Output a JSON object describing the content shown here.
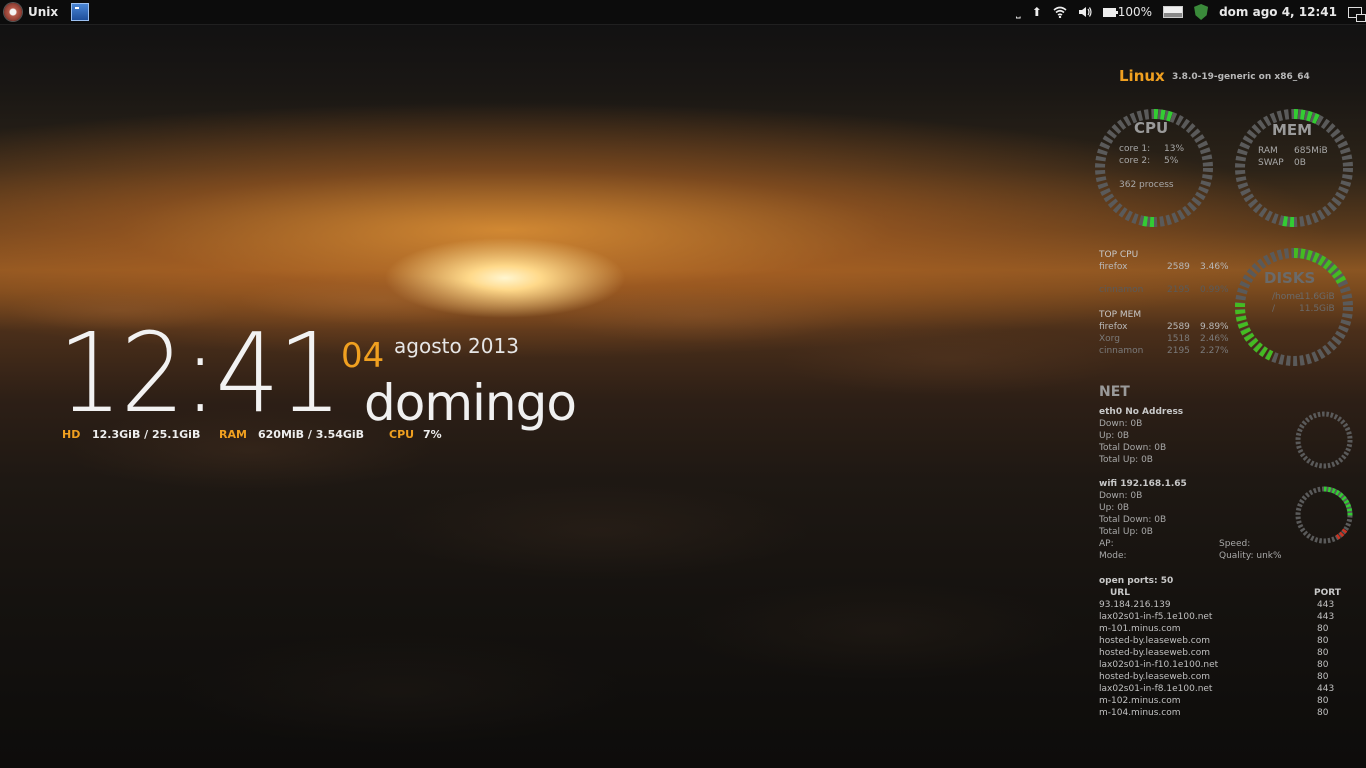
{
  "panel": {
    "menu_label": "Unix",
    "battery": "100%",
    "clock": "dom ago  4, 12:41"
  },
  "desktop_clock": {
    "time": "12:41",
    "day": "04",
    "month_year": "agosto 2013",
    "weekday": "domingo",
    "hd_label": "HD",
    "hd_value": "12.3GiB / 25.1GiB",
    "ram_label": "RAM",
    "ram_value": "620MiB  / 3.54GiB",
    "cpu_label": "CPU",
    "cpu_value": "7%"
  },
  "conky": {
    "os": "Linux",
    "kernel": "3.8.0-19-generic on x86_64",
    "cpu": {
      "title": "CPU",
      "core1_label": "core 1:",
      "core1_value": "13%",
      "core2_label": "core 2:",
      "core2_value": "5%",
      "process": "362 process"
    },
    "mem": {
      "title": "MEM",
      "ram_label": "RAM",
      "ram_value": "685MiB",
      "swap_label": "SWAP",
      "swap_value": "0B"
    },
    "disks": {
      "title": "DISKS",
      "home_label": "/home",
      "home_value": "11.6GiB",
      "root_label": "/",
      "root_value": "11.5GiB"
    },
    "top_cpu": {
      "title": "TOP CPU",
      "rows": [
        {
          "name": "firefox",
          "pid": "2589",
          "val": "3.46%"
        },
        {
          "name": "cinnamon",
          "pid": "2195",
          "val": "0.99%"
        }
      ]
    },
    "top_mem": {
      "title": "TOP MEM",
      "rows": [
        {
          "name": "firefox",
          "pid": "2589",
          "val": "9.89%"
        },
        {
          "name": "Xorg",
          "pid": "1518",
          "val": "2.46%"
        },
        {
          "name": "cinnamon",
          "pid": "2195",
          "val": "2.27%"
        }
      ]
    },
    "net": {
      "title": "NET",
      "eth0": {
        "header": "eth0 No Address",
        "down": "Down: 0B",
        "up": "Up: 0B",
        "total_down": "Total Down: 0B",
        "total_up": "Total Up: 0B"
      },
      "wifi": {
        "header": "wifi 192.168.1.65",
        "down": "Down: 0B",
        "up": "Up: 0B",
        "total_down": "Total Down: 0B",
        "total_up": "Total Up: 0B",
        "ap": "AP:",
        "speed": "Speed:",
        "mode": "Mode:",
        "quality": "Quality: unk%"
      }
    },
    "ports": {
      "title": "open ports:   50",
      "col_url": "URL",
      "col_port": "PORT",
      "rows": [
        {
          "url": "93.184.216.139",
          "port": "443"
        },
        {
          "url": "lax02s01-in-f5.1e100.net",
          "port": "443"
        },
        {
          "url": "m-101.minus.com",
          "port": "80"
        },
        {
          "url": "hosted-by.leaseweb.com",
          "port": "80"
        },
        {
          "url": "hosted-by.leaseweb.com",
          "port": "80"
        },
        {
          "url": "lax02s01-in-f10.1e100.net",
          "port": "80"
        },
        {
          "url": "hosted-by.leaseweb.com",
          "port": "80"
        },
        {
          "url": "lax02s01-in-f8.1e100.net",
          "port": "443"
        },
        {
          "url": "m-102.minus.com",
          "port": "80"
        },
        {
          "url": "m-104.minus.com",
          "port": "80"
        }
      ]
    }
  }
}
